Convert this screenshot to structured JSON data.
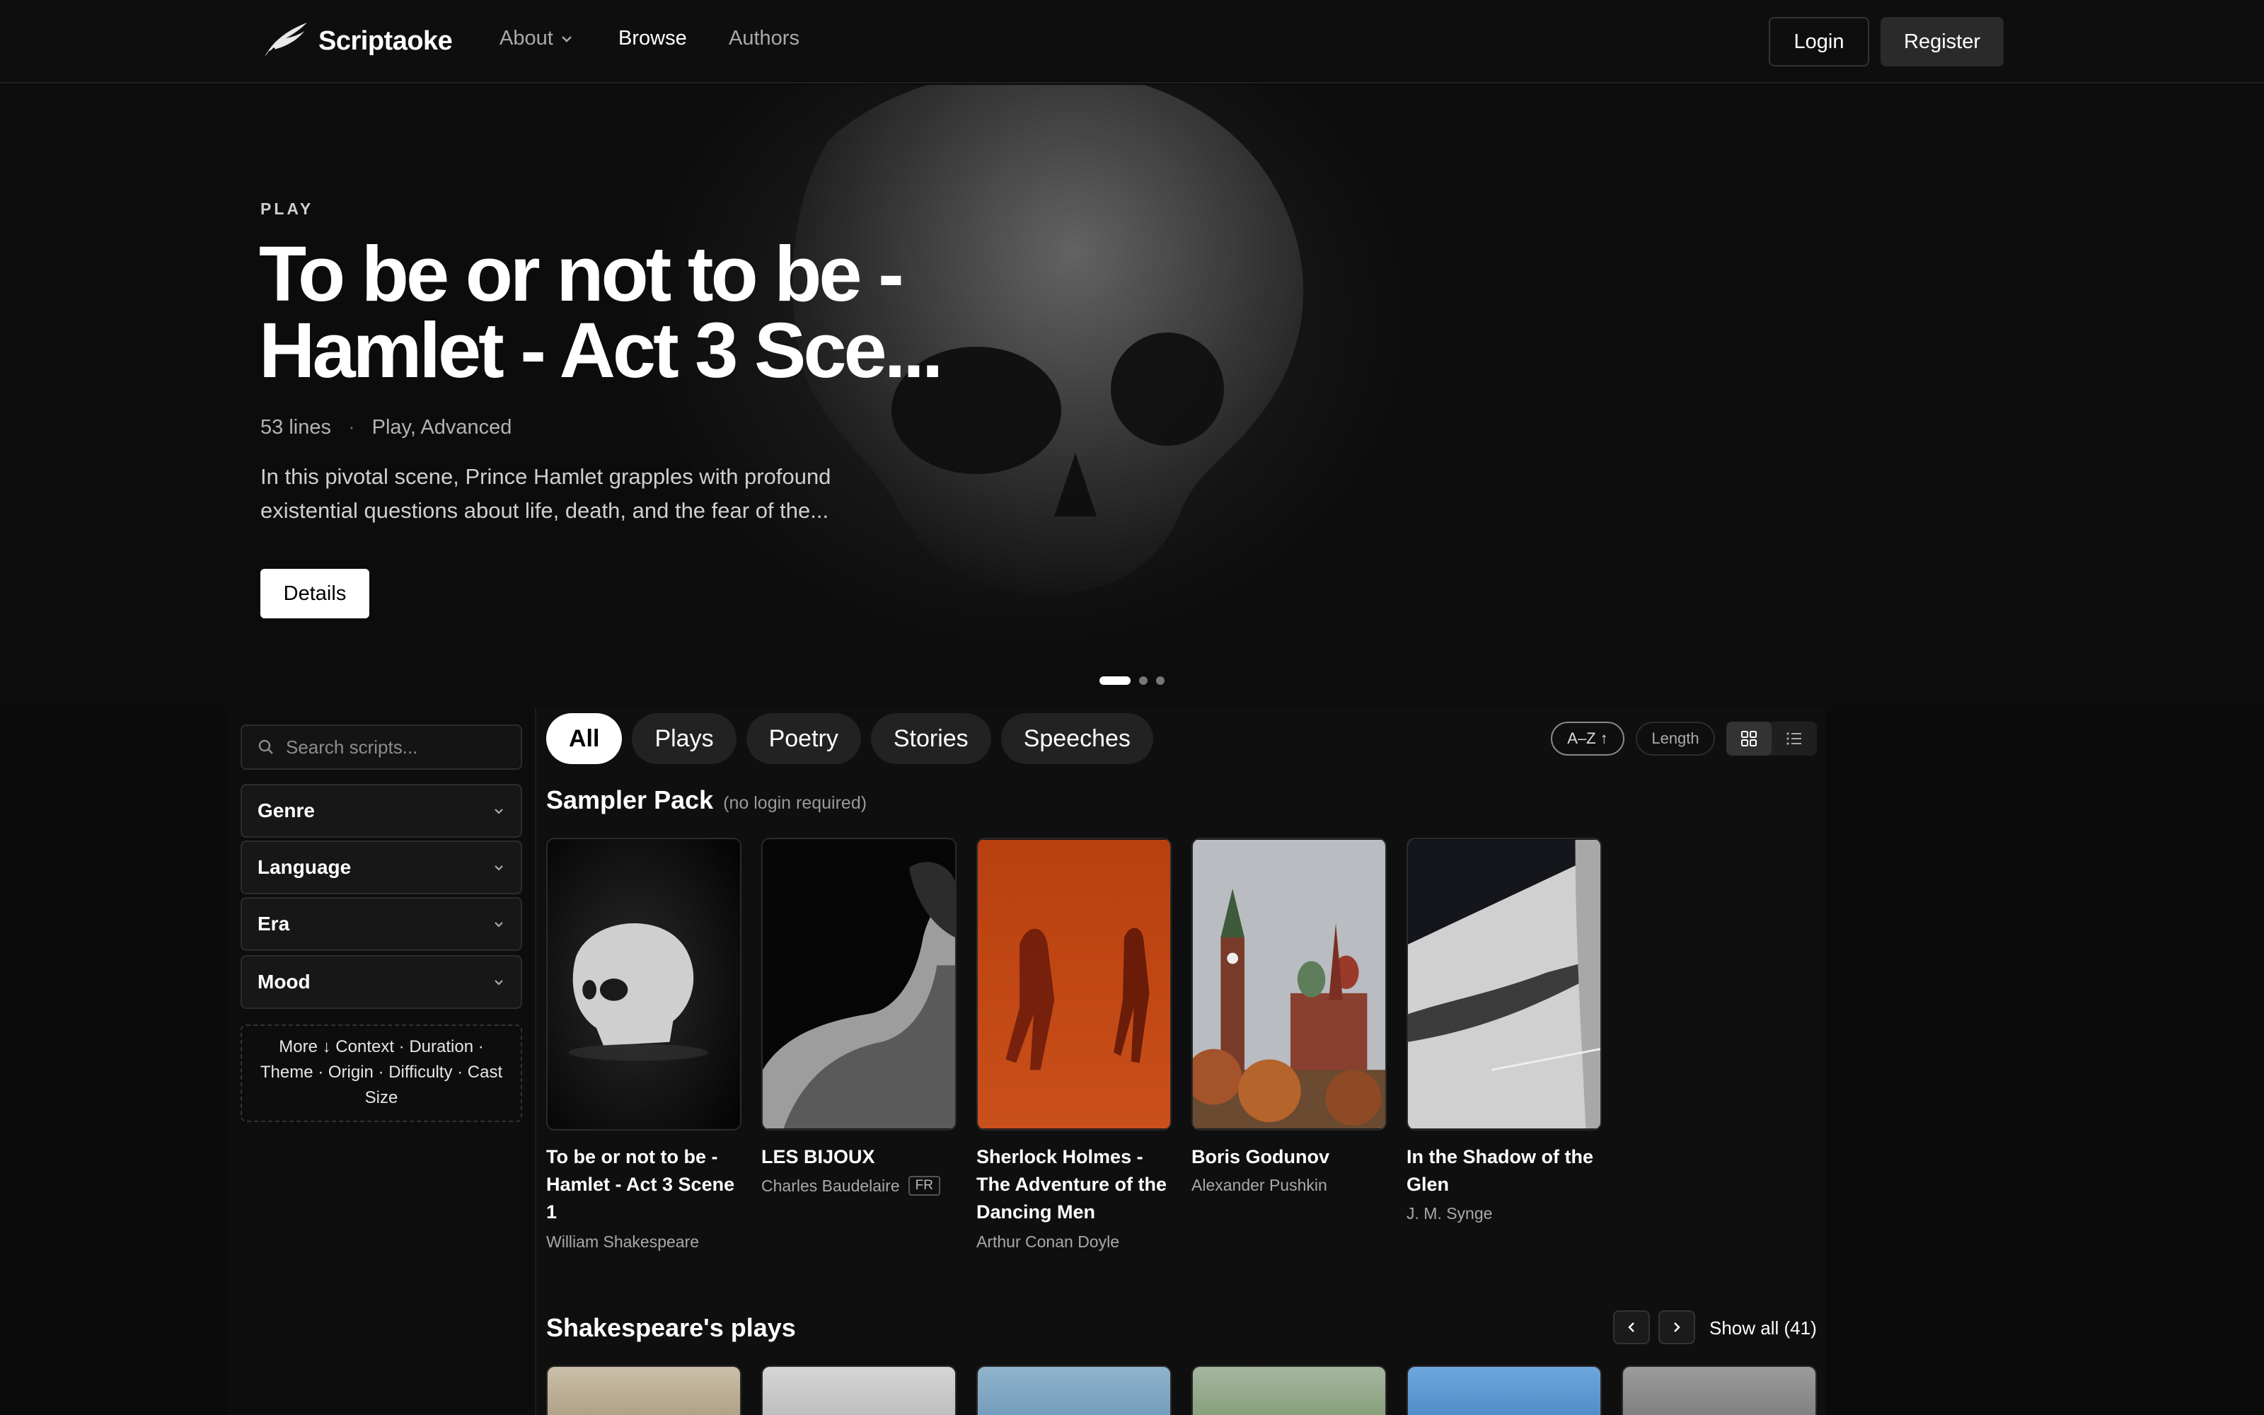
{
  "app": {
    "name": "Scriptaoke"
  },
  "nav": {
    "links": [
      {
        "label": "About",
        "has_dropdown": true
      },
      {
        "label": "Browse",
        "active": true
      },
      {
        "label": "Authors"
      }
    ],
    "login_label": "Login",
    "register_label": "Register"
  },
  "hero": {
    "eyebrow": "PLAY",
    "title": "To be or not to be - Hamlet - Act 3 Sce...",
    "lines": "53 lines",
    "tags": "Play, Advanced",
    "description": "In this pivotal scene, Prince Hamlet grapples with profound existential questions about life, death, and the fear of the...",
    "details_label": "Details",
    "slides": 3,
    "active_slide": 1
  },
  "sidebar": {
    "search_placeholder": "Search scripts...",
    "facets": [
      "Genre",
      "Language",
      "Era",
      "Mood"
    ],
    "more_text": "More ↓ Context · Duration · Theme · Origin · Difficulty · Cast Size"
  },
  "tabs": [
    "All",
    "Plays",
    "Poetry",
    "Stories",
    "Speeches"
  ],
  "sort": {
    "az_label": "A–Z ↑",
    "length_label": "Length"
  },
  "sampler": {
    "title": "Sampler Pack",
    "note": "(no login required)",
    "cards": [
      {
        "title": "To be or not to be - Hamlet - Act 3 Scene 1",
        "author": "William Shakespeare",
        "badge": ""
      },
      {
        "title": "LES BIJOUX",
        "author": "Charles Baudelaire",
        "badge": "FR"
      },
      {
        "title": "Sherlock Holmes - The Adventure of the Dancing Men",
        "author": "Arthur Conan Doyle",
        "badge": ""
      },
      {
        "title": "Boris Godunov",
        "author": "Alexander Pushkin",
        "badge": ""
      },
      {
        "title": "In the Shadow of the Glen",
        "author": "J. M. Synge",
        "badge": ""
      }
    ]
  },
  "shakespeare": {
    "title": "Shakespeare's plays",
    "show_all_label": "Show all (41)"
  },
  "icons": {
    "logo": "quill-logo-icon",
    "search": "search-icon",
    "chevron": "chevron-down-icon",
    "grid": "grid-view-icon",
    "list": "list-view-icon",
    "prev": "chevron-left-icon",
    "next": "chevron-right-icon"
  }
}
